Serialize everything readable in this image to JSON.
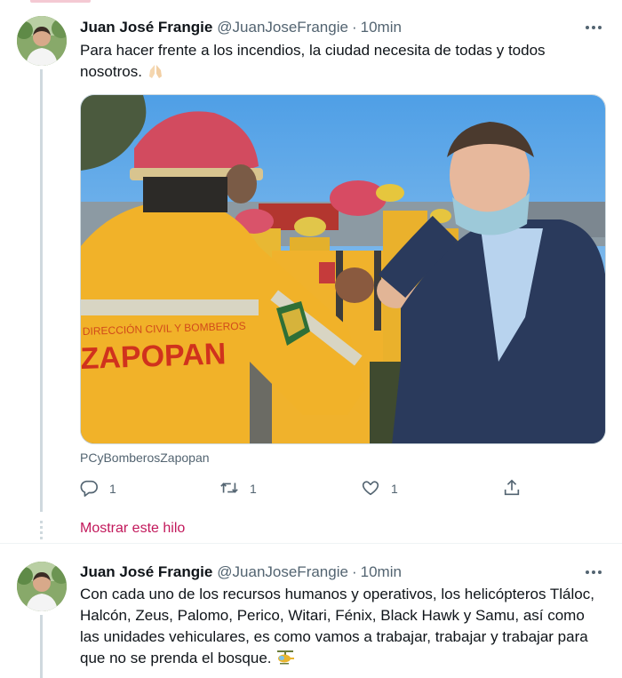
{
  "colors": {
    "accent": "#c2185b",
    "text": "#0f1419",
    "secondary": "#536471",
    "thread_line": "#cfd9de"
  },
  "tweets": [
    {
      "author_name": "Juan José Frangie",
      "handle": "@JuanJoseFrangie",
      "separator": "·",
      "time": "10min",
      "text": "Para hacer frente a los incendios, la ciudad necesita de todas y todos nosotros.",
      "emoji": "folded-hands",
      "media_source": "PCyBomberosZapopan",
      "media_text": {
        "jacket_line_1": "DIRECCIÓN CIVIL Y BOMBEROS",
        "jacket_line_2": "ZAPOPAN"
      },
      "reply_count": "1",
      "retweet_count": "1",
      "like_count": "1"
    },
    {
      "author_name": "Juan José Frangie",
      "handle": "@JuanJoseFrangie",
      "separator": "·",
      "time": "10min",
      "text": "Con cada uno de los recursos humanos y operativos, los helicópteros Tláloc, Halcón, Zeus, Palomo, Perico, Witari, Fénix, Black Hawk y Samu, así como las unidades vehiculares, es como vamos a trabajar, trabajar y trabajar para que no se prenda el bosque.",
      "emoji": "helicopter"
    }
  ],
  "show_thread_label": "Mostrar este hilo",
  "icons": {
    "more": "more-horizontal-icon",
    "reply": "reply-icon",
    "retweet": "retweet-icon",
    "like": "heart-icon",
    "share": "share-icon"
  }
}
